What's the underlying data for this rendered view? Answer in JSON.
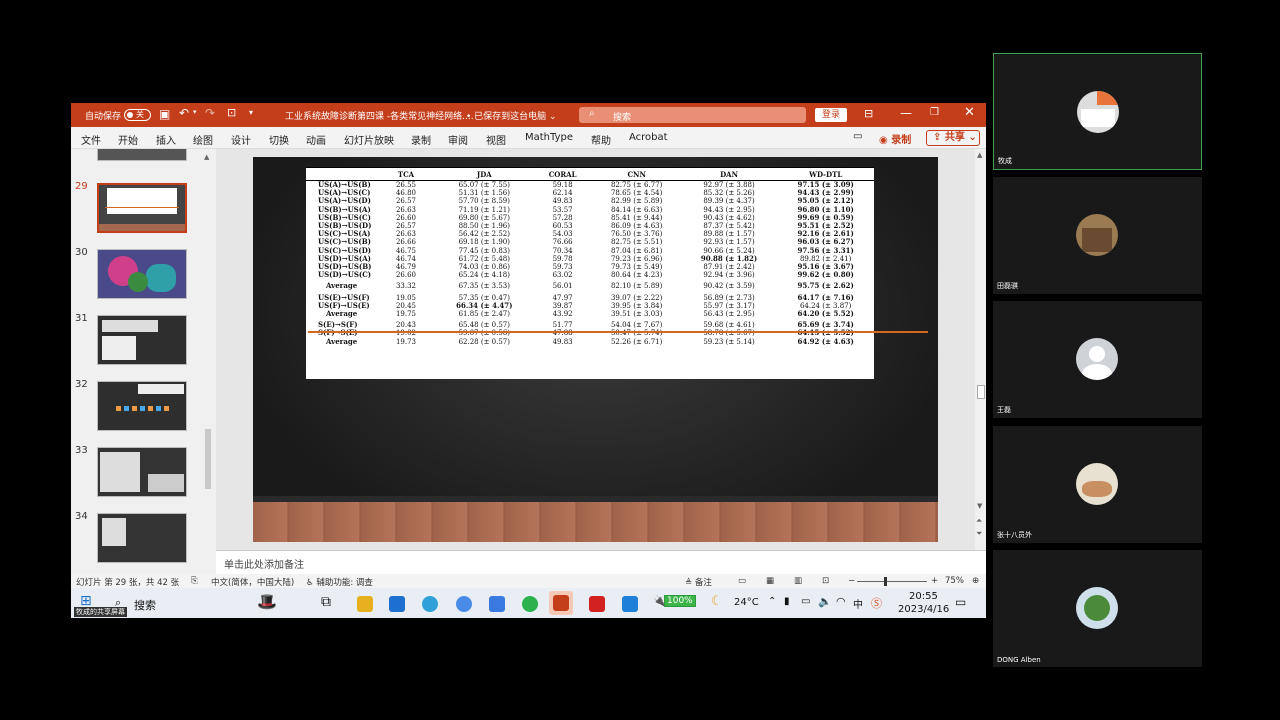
{
  "window": {
    "autosave_label": "自动保存",
    "autosave_state": "关",
    "doc_title": "工业系统故障诊断第四课 -各类常见神经网络....",
    "save_status": "已保存到这台电脑",
    "search_placeholder": "搜索",
    "login_label": "登录"
  },
  "menu": {
    "tabs": [
      "文件",
      "开始",
      "插入",
      "绘图",
      "设计",
      "切换",
      "动画",
      "幻灯片放映",
      "录制",
      "审阅",
      "视图",
      "MathType",
      "帮助",
      "Acrobat"
    ],
    "record_label": "录制",
    "share_label": "共享"
  },
  "thumbnails": {
    "numbers": [
      "29",
      "30",
      "31",
      "32",
      "33",
      "34"
    ],
    "selected": "29"
  },
  "table": {
    "headers": [
      "",
      "TCA",
      "JDA",
      "CORAL",
      "CNN",
      "DAN",
      "WD-DTL"
    ],
    "rows": [
      [
        "US(A)→US(B)",
        "26.55",
        "65.07 (± 7.55)",
        "59.18",
        "82.75 (± 6.77)",
        "92.97 (± 3.88)",
        "97.15 (± 3.09)"
      ],
      [
        "US(A)→US(C)",
        "46.80",
        "51.31 (± 1.56)",
        "62.14",
        "78.65 (± 4.54)",
        "85.32 (± 5.26)",
        "94.43 (± 2.99)"
      ],
      [
        "US(A)→US(D)",
        "26.57",
        "57.70 (± 8.59)",
        "49.83",
        "82.99 (± 5.89)",
        "89.39 (± 4.37)",
        "95.05 (± 2.12)"
      ],
      [
        "US(B)→US(A)",
        "26.63",
        "71.19 (± 1.21)",
        "53.57",
        "84.14 (± 6.63)",
        "94.43 (± 2.95)",
        "96.80 (± 1.10)"
      ],
      [
        "US(B)→US(C)",
        "26.60",
        "69.80 (± 5.67)",
        "57.28",
        "85.41 (± 9.44)",
        "90.43 (± 4.62)",
        "99.69 (± 0.59)"
      ],
      [
        "US(B)→US(D)",
        "26.57",
        "88.50 (± 1.96)",
        "60.53",
        "86.09 (± 4.63)",
        "87.37 (± 5.42)",
        "95.51 (± 2.52)"
      ],
      [
        "US(C)→US(A)",
        "26.63",
        "56.42 (± 2.52)",
        "54.03",
        "76.50 (± 3.76)",
        "89.88 (± 1.57)",
        "92.16 (± 2.61)"
      ],
      [
        "US(C)→US(B)",
        "26.66",
        "69.18 (± 1.90)",
        "76.66",
        "82.75 (± 5.51)",
        "92.93 (± 1.57)",
        "96.03 (± 6.27)"
      ],
      [
        "US(C)→US(D)",
        "46.75",
        "77.45 (± 0.83)",
        "70.34",
        "87.04 (± 6.81)",
        "90.66 (± 5.24)",
        "97.56 (± 3.31)"
      ],
      [
        "US(D)→US(A)",
        "46.74",
        "61.72 (± 5.48)",
        "59.78",
        "79.23 (± 6.96)",
        "90.88 (± 1.82)",
        "89.82 (± 2.41)"
      ],
      [
        "US(D)→US(B)",
        "46.79",
        "74.03 (± 0.86)",
        "59.73",
        "79.73 (± 5.49)",
        "87.91 (± 2.42)",
        "95.16 (± 3.67)"
      ],
      [
        "US(D)→US(C)",
        "26.60",
        "65.24 (± 4.18)",
        "63.02",
        "80.64 (± 4.23)",
        "92.94 (± 3.96)",
        "99.62 (± 0.80)"
      ],
      [
        "Average",
        "33.32",
        "67.35 (± 3.53)",
        "56.01",
        "82.10 (± 5.89)",
        "90.42 (± 3.59)",
        "95.75 (± 2.62)"
      ],
      [
        "US(E)→US(F)",
        "19.05",
        "57.35 (± 0.47)",
        "47.97",
        "39.07 (± 2.22)",
        "56.89 (± 2.73)",
        "64.17 (± 7.16)"
      ],
      [
        "US(F)→US(E)",
        "20.45",
        "66.34 (± 4.47)",
        "39.87",
        "39.95 (± 3.84)",
        "55.97 (± 3.17)",
        "64.24 (± 3.87)"
      ],
      [
        "Average",
        "19.75",
        "61.85 (± 2.47)",
        "43.92",
        "39.51 (± 3.03)",
        "56.43 (± 2.95)",
        "64.20 (± 5.52)"
      ],
      [
        "S(E)→S(F)",
        "20.43",
        "65.48 (± 0.57)",
        "51.77",
        "54.04 (± 7.67)",
        "59.68 (± 4.61)",
        "65.69 (± 3.74)"
      ],
      [
        "S(F)→S(E)",
        "19.02",
        "59.07 (± 0.56)",
        "47.88",
        "50.47 (± 5.74)",
        "58.78 (± 5.67)",
        "64.15 (± 5.52)"
      ],
      [
        "Average",
        "19.73",
        "62.28 (± 0.57)",
        "49.83",
        "52.26 (± 6.71)",
        "59.23 (± 5.14)",
        "64.92 (± 4.63)"
      ]
    ]
  },
  "notes_placeholder": "单击此处添加备注",
  "status": {
    "slide_info": "幻灯片 第 29 张，共 42 张",
    "language": "中文(简体，中国大陆)",
    "accessibility": "辅助功能: 调查",
    "notes_btn": "备注",
    "zoom": "75%"
  },
  "taskbar": {
    "search": "搜索",
    "share_label": "牧成的共享屏幕",
    "battery": "100%",
    "weather": "24°C",
    "ime": "中",
    "time": "20:55",
    "date": "2023/4/16"
  },
  "participants": [
    "牧成",
    "田磊骐",
    "王磊",
    "张十八员外",
    "DONG Alben"
  ]
}
